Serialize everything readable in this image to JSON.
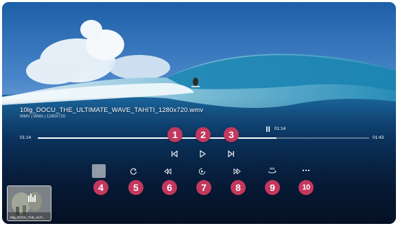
{
  "video": {
    "file_name": "10lg_DOCU_THE_ULTIMATE_WAVE_TAHITI_1280x720.wmv",
    "format_info": "WMV | WMA | 1280X720"
  },
  "progress": {
    "current_time": "01:14",
    "total_time": "01:43",
    "preview_time": "01:14",
    "fraction": 0.72
  },
  "controls": {
    "previous_icon": "skip-previous-icon",
    "play_icon": "play-icon",
    "next_icon": "skip-next-icon",
    "playlist_icon": "playlist-icon",
    "repeat_icon": "repeat-icon",
    "rewind_icon": "rewind-icon",
    "speed_icon": "playback-speed-icon",
    "fast_forward_icon": "fast-forward-icon",
    "rotate_icon": "rotate-360-icon",
    "more_icon": "more-options-icon"
  },
  "callouts": [
    "1",
    "2",
    "3",
    "4",
    "5",
    "6",
    "7",
    "8",
    "9",
    "10"
  ],
  "playlist": {
    "thumbnail_label": "10lg_DOCU_THE_ULTI..."
  },
  "colors": {
    "callout_badge": "#c2385e",
    "progress_played": "#ffffff"
  }
}
